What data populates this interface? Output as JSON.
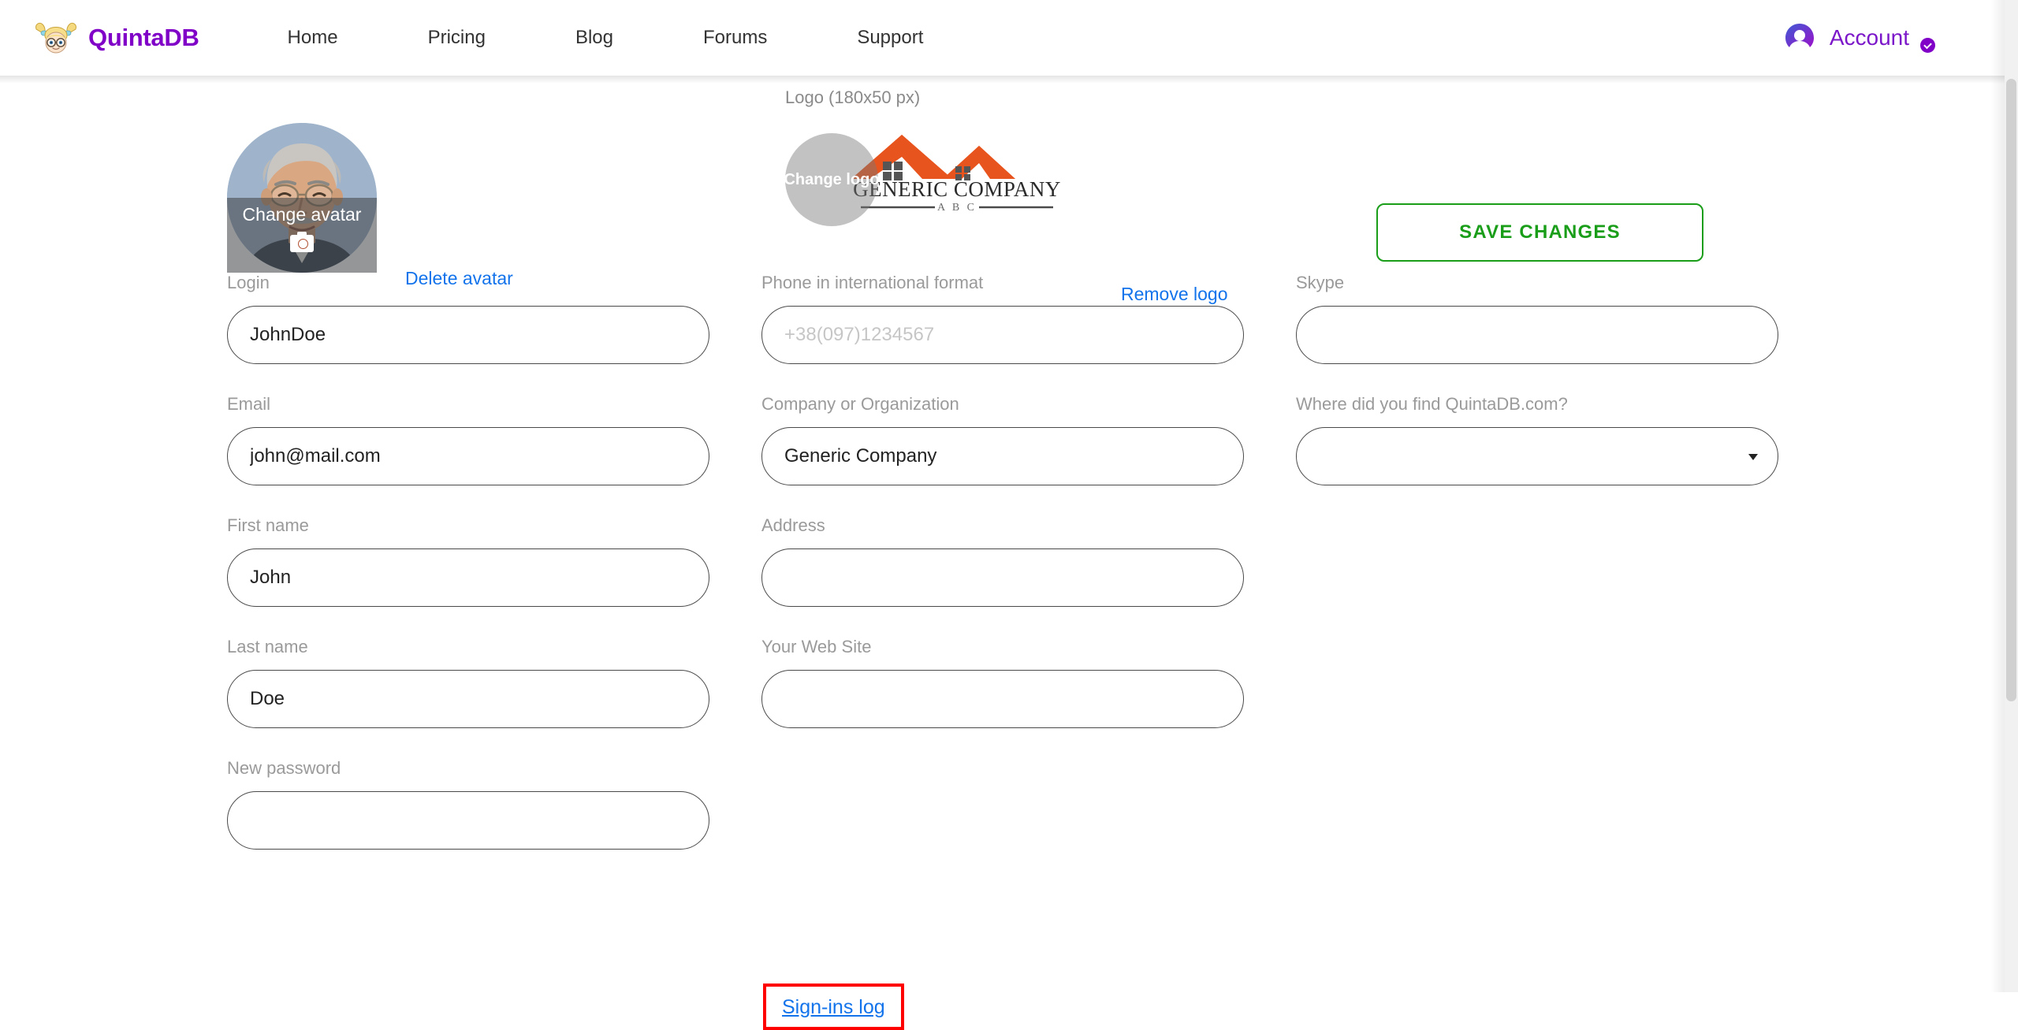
{
  "header": {
    "brand_name": "QuintaDB",
    "nav": [
      {
        "label": "Home"
      },
      {
        "label": "Pricing"
      },
      {
        "label": "Blog"
      },
      {
        "label": "Forums"
      },
      {
        "label": "Support"
      }
    ],
    "account_label": "Account"
  },
  "avatar": {
    "overlay_label": "Change avatar",
    "delete_link": "Delete avatar"
  },
  "logo": {
    "caption": "Logo (180x50 px)",
    "overlay_label": "Change logo",
    "remove_link": "Remove logo",
    "company_text": "GENERIC COMPANY",
    "company_subtext": "A B C"
  },
  "actions": {
    "save_changes": "SAVE CHANGES",
    "signins_log": "Sign-ins log"
  },
  "form": {
    "column1": [
      {
        "label": "Login",
        "value": "JohnDoe",
        "placeholder": "",
        "type": "text"
      },
      {
        "label": "Email",
        "value": "john@mail.com",
        "placeholder": "",
        "type": "text"
      },
      {
        "label": "First name",
        "value": "John",
        "placeholder": "",
        "type": "text"
      },
      {
        "label": "Last name",
        "value": "Doe",
        "placeholder": "",
        "type": "text"
      },
      {
        "label": "New password",
        "value": "",
        "placeholder": "",
        "type": "password"
      }
    ],
    "column2": [
      {
        "label": "Phone in international format",
        "value": "",
        "placeholder": "+38(097)1234567",
        "type": "text"
      },
      {
        "label": "Company or Organization",
        "value": "Generic Company",
        "placeholder": "",
        "type": "text"
      },
      {
        "label": "Address",
        "value": "",
        "placeholder": "",
        "type": "text"
      },
      {
        "label": "Your Web Site",
        "value": "",
        "placeholder": "",
        "type": "text"
      }
    ],
    "column3": [
      {
        "label": "Skype",
        "value": "",
        "placeholder": "",
        "type": "text"
      },
      {
        "label": "Where did you find QuintaDB.com?",
        "value": "",
        "placeholder": "",
        "type": "select",
        "options": [
          ""
        ]
      }
    ]
  },
  "colors": {
    "brand_purple": "#8000C8",
    "account_purple": "#7B16C9",
    "link_blue": "#1273EB",
    "save_green": "#1A9E1A",
    "highlight_red": "#FF0000",
    "label_gray": "#9a9a9a",
    "logo_orange": "#E8541E"
  }
}
